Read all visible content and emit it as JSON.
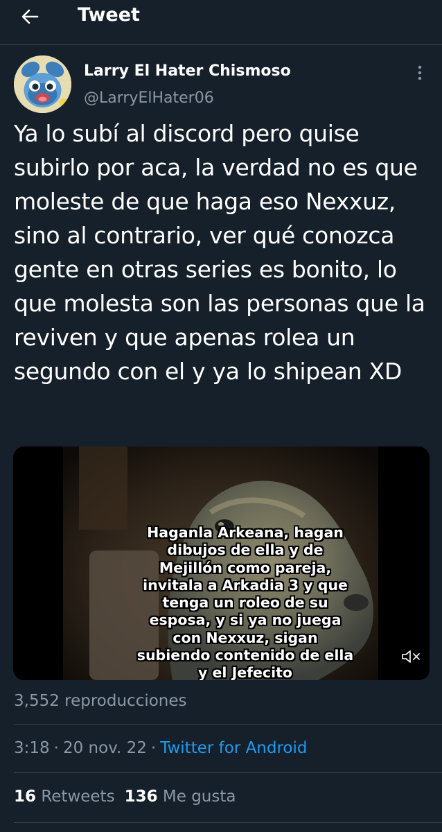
{
  "header": {
    "title": "Tweet",
    "back_icon": "arrow-left-icon"
  },
  "author": {
    "display_name": "Larry El Hater Chismoso",
    "handle": "@LarryElHater06",
    "avatar_icon": "sobble-avatar"
  },
  "tweet": {
    "text": "Ya lo subí al discord pero quise subirlo por aca, la verdad no es que moleste de que haga eso Nexxuz, sino al contrario, ver qué conozca gente en otras series es bonito, lo que molesta son las personas que la reviven y que apenas rolea un segundo con el y ya lo shipean XD"
  },
  "media": {
    "caption": "Haganla Arkeana, hagan\ndibujos de ella y de\nMejillón como pareja,\ninvitala a Arkadia 3 y que\ntenga un roleo de su\nesposa, y si ya no juega\ncon Nexxuz, sigan\nsubiendo contenido de ella\ny el Jefecito",
    "mute_icon": "muted-speaker-icon"
  },
  "views": "3,552 reproducciones",
  "meta": {
    "time": "3:18",
    "separator": "·",
    "date": "20 nov. 22",
    "source": "Twitter for Android"
  },
  "stats": {
    "retweets_count": "16",
    "retweets_label": "Retweets",
    "likes_count": "136",
    "likes_label": "Me gusta"
  },
  "colors": {
    "background": "#15202b",
    "secondary_text": "#8b98a5",
    "link": "#1d9bf0",
    "divider": "#38444d"
  }
}
